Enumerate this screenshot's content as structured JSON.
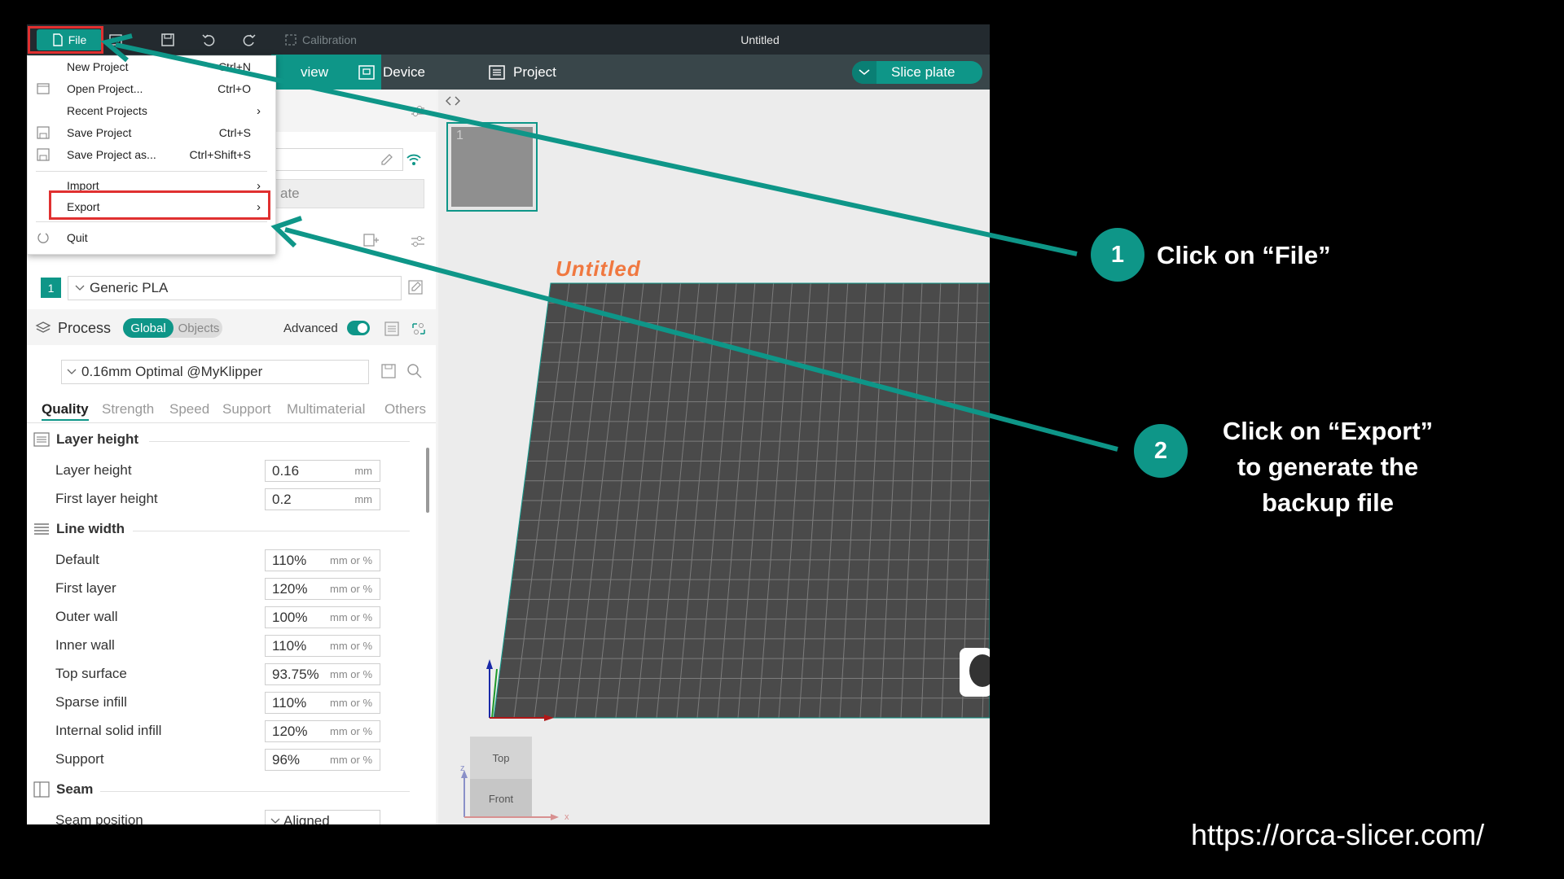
{
  "titlebar": {
    "file_label": "File",
    "calibration_label": "Calibration",
    "window_title": "Untitled"
  },
  "tabs": {
    "preview_partial": "view",
    "device_label": "Device",
    "project_label": "Project",
    "slice_label": "Slice plate"
  },
  "file_menu": {
    "items": [
      {
        "label": "New Project",
        "shortcut": "Ctrl+N"
      },
      {
        "label": "Open Project...",
        "shortcut": "Ctrl+O"
      },
      {
        "label": "Recent Projects",
        "shortcut": ""
      },
      {
        "label": "Save Project",
        "shortcut": "Ctrl+S"
      },
      {
        "label": "Save Project as...",
        "shortcut": "Ctrl+Shift+S"
      },
      {
        "label": "Import",
        "shortcut": ""
      },
      {
        "label": "Export",
        "shortcut": ""
      },
      {
        "label": "Quit",
        "shortcut": ""
      }
    ]
  },
  "printer": {
    "preset_partial": "ate"
  },
  "filament": {
    "index": "1",
    "name": "Generic PLA"
  },
  "process": {
    "title": "Process",
    "global_label": "Global",
    "objects_label": "Objects",
    "advanced_label": "Advanced",
    "preset": "0.16mm Optimal @MyKlipper",
    "tabs": [
      "Quality",
      "Strength",
      "Speed",
      "Support",
      "Multimaterial",
      "Others"
    ]
  },
  "settings": {
    "layer_height_section": "Layer height",
    "layer_height_rows": [
      {
        "label": "Layer height",
        "value": "0.16",
        "unit": "mm"
      },
      {
        "label": "First layer height",
        "value": "0.2",
        "unit": "mm"
      }
    ],
    "line_width_section": "Line width",
    "line_width_rows": [
      {
        "label": "Default",
        "value": "110%",
        "unit": "mm or %"
      },
      {
        "label": "First layer",
        "value": "120%",
        "unit": "mm or %"
      },
      {
        "label": "Outer wall",
        "value": "100%",
        "unit": "mm or %"
      },
      {
        "label": "Inner wall",
        "value": "110%",
        "unit": "mm or %"
      },
      {
        "label": "Top surface",
        "value": "93.75%",
        "unit": "mm or %"
      },
      {
        "label": "Sparse infill",
        "value": "110%",
        "unit": "mm or %"
      },
      {
        "label": "Internal solid infill",
        "value": "120%",
        "unit": "mm or %"
      },
      {
        "label": "Support",
        "value": "96%",
        "unit": "mm or %"
      }
    ],
    "seam_section": "Seam",
    "seam_position_label": "Seam position",
    "seam_position_value": "Aligned"
  },
  "viewport": {
    "plate_thumb_index": "1",
    "plate_name": "Untitled",
    "view_top": "Top",
    "view_front": "Front",
    "axis_z": "z",
    "axis_x": "x"
  },
  "annotations": {
    "step1_number": "1",
    "step1_text": "Click on “File”",
    "step2_number": "2",
    "step2_line1": "Click on “Export”",
    "step2_line2": "to generate the",
    "step2_line3": "backup file",
    "url": "https://orca-slicer.com/"
  },
  "colors": {
    "accent": "#0e9688",
    "highlight": "#e03030",
    "plate_title": "#f07840"
  }
}
